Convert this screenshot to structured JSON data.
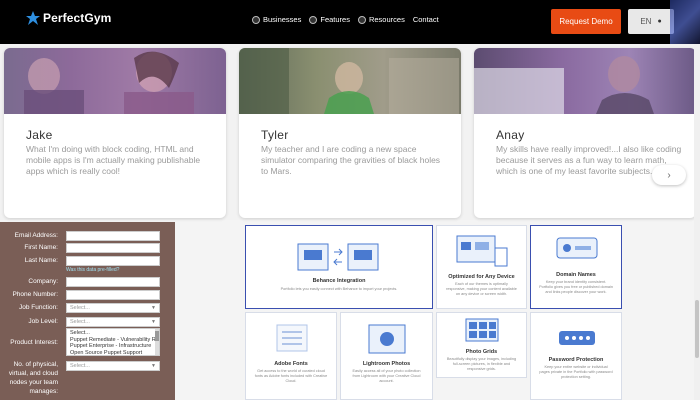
{
  "nav": {
    "logo_text": "PerfectGym",
    "menu": [
      {
        "label": "Businesses",
        "icon": "globe-icon"
      },
      {
        "label": "Features",
        "icon": "gear-icon"
      },
      {
        "label": "Resources",
        "icon": "book-icon"
      },
      {
        "label": "Contact",
        "icon": ""
      }
    ],
    "cta_label": "Request Demo",
    "lang_label": "EN",
    "colors": {
      "cta": "#e84b14",
      "bar": "#000000"
    }
  },
  "testimonials": [
    {
      "name": "Jake",
      "quote": "What I'm doing with block coding, HTML and mobile apps is I'm actually making publishable apps which is really cool!"
    },
    {
      "name": "Tyler",
      "quote": "My teacher and I are coding a new space simulator comparing the gravities of black holes to Mars."
    },
    {
      "name": "Anay",
      "quote": "My skills have really improved!...I also like coding because it serves as a fun way to learn math, which is one of my least favorite subjects."
    }
  ],
  "form": {
    "fields": [
      {
        "label": "Email Address:",
        "type": "input",
        "value": ""
      },
      {
        "label": "First Name:",
        "type": "input",
        "value": ""
      },
      {
        "label": "Last Name:",
        "type": "input",
        "value": ""
      },
      {
        "label": "Company:",
        "type": "input",
        "value": ""
      },
      {
        "label": "Phone Number:",
        "type": "input",
        "value": ""
      },
      {
        "label": "Job Function:",
        "type": "select",
        "value": "Select..."
      },
      {
        "label": "Job Level:",
        "type": "select",
        "value": "Select..."
      }
    ],
    "link_text": "Was this data pre-filled?",
    "interest_label": "Product Interest:",
    "interest_options": [
      "Select...",
      "Puppet Remediate - Vulnerability R",
      "Puppet Enterprise - Infrastructure",
      "Open Source Puppet Support"
    ],
    "last_label_line1": "No. of physical,",
    "last_label_line2": "virtual, and cloud",
    "last_label_line3": "nodes your team",
    "last_label_line4": "manages:",
    "last_value": "Select..."
  },
  "features": [
    {
      "title": "Behance Integration",
      "desc": "Portfolio lets you easily connect with Behance to import your projects."
    },
    {
      "title": "Optimized for Any Device",
      "desc": "Each of our themes is optimally responsive, making your content available on any device or screen width."
    },
    {
      "title": "Domain Names",
      "desc": "Keep your brand identity consistent. Portfolio gives you free or published domain and links people discover your work."
    },
    {
      "title": "Adobe Fonts",
      "desc": "Get access to the world of curated cloud fonts as Adobe fonts included with Creative Cloud."
    },
    {
      "title": "Lightroom Photos",
      "desc": "Easily access all of your photo collection from Lightroom with your Creative Cloud account."
    },
    {
      "title": "Photo Grids",
      "desc": "Beautifully display your images, including full-screen pictures, in flexible and responsive grids."
    },
    {
      "title": "Password Protection",
      "desc": "Keep your entire website or individual pages private in the Portfolio with password protection setting."
    }
  ],
  "next_arrow": "›"
}
